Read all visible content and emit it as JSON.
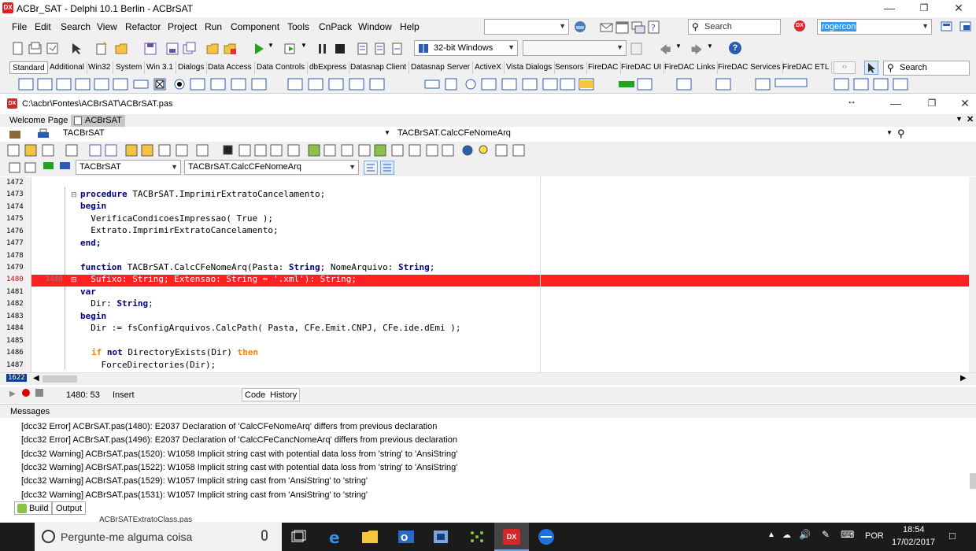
{
  "window": {
    "title": "ACBr_SAT - Delphi 10.1 Berlin - ACBrSAT",
    "logo": "DX"
  },
  "menu": [
    "File",
    "Edit",
    "Search",
    "View",
    "Refactor",
    "Project",
    "Run",
    "Component",
    "Tools",
    "CnPack",
    "Window",
    "Help"
  ],
  "toolbar": {
    "search_placeholder": "Search",
    "layout_value": "rogercon",
    "platform": "32-bit Windows",
    "help_label": "?"
  },
  "palette": {
    "tabs": [
      "Standard",
      "Additional",
      "Win32",
      "System",
      "Win 3.1",
      "Dialogs",
      "Data Access",
      "Data Controls",
      "dbExpress",
      "Datasnap Client",
      "Datasnap Server",
      "ActiveX",
      "Vista Dialogs",
      "Sensors",
      "FireDAC",
      "FireDAC UI",
      "FireDAC Links",
      "FireDAC Services",
      "FireDAC ETL"
    ],
    "search_placeholder": "Search"
  },
  "editor": {
    "path": "C:\\acbr\\Fontes\\ACBrSAT\\ACBrSAT.pas",
    "tabs": [
      "Welcome Page",
      "ACBrSAT"
    ],
    "nav_class": "TACBrSAT",
    "nav_method": "TACBrSAT.CalcCFeNomeArq",
    "combo_class": "TACBrSAT",
    "combo_method": "TACBrSAT.CalcCFeNomeArq",
    "line_numbers": [
      "1472",
      "1473",
      "1474",
      "1475",
      "1476",
      "1477",
      "1478",
      "1479",
      "1480",
      "1481",
      "1482",
      "1483",
      "1484",
      "1485",
      "1486",
      "1487"
    ],
    "error_marker": "1480",
    "current_line_badge": "1622",
    "code": {
      "l1473a": "procedure",
      "l1473b": " TACBrSAT.ImprimirExtratoCancelamento;",
      "l1474": "begin",
      "l1475": "  VerificaCondicoesImpressao( True );",
      "l1476": "  Extrato.ImprimirExtratoCancelamento;",
      "l1477": "end;",
      "l1479a": "function",
      "l1479b": " TACBrSAT.CalcCFeNomeArq(Pasta: ",
      "l1479c": "String",
      "l1479d": "; NomeArquivo: ",
      "l1479e": "String",
      "l1479f": ";",
      "l1480": "  Sufixo: String; Extensao: String = '.xml'): String;",
      "l1481": "var",
      "l1482a": "  Dir: ",
      "l1482b": "String",
      "l1482c": ";",
      "l1483": "begin",
      "l1484": "  Dir := fsConfigArquivos.CalcPath( Pasta, CFe.Emit.CNPJ, CFe.ide.dEmi );",
      "l1486a": "if",
      "l1486b": "not",
      "l1486c": " DirectoryExists(Dir) ",
      "l1486d": "then",
      "l1487": "    ForceDirectories(Dir);"
    },
    "status": {
      "position": "1480: 53",
      "mode": "Insert",
      "code_tab": "Code",
      "history_tab": "History"
    }
  },
  "messages": {
    "title": "Messages",
    "items": [
      "[dcc32 Error] ACBrSAT.pas(1480): E2037 Declaration of 'CalcCFeNomeArq' differs from previous declaration",
      "[dcc32 Error] ACBrSAT.pas(1496): E2037 Declaration of 'CalcCFeCancNomeArq' differs from previous declaration",
      "[dcc32 Warning] ACBrSAT.pas(1520): W1058 Implicit string cast with potential data loss from 'string' to 'AnsiString'",
      "[dcc32 Warning] ACBrSAT.pas(1522): W1058 Implicit string cast with potential data loss from 'string' to 'AnsiString'",
      "[dcc32 Warning] ACBrSAT.pas(1529): W1057 Implicit string cast from 'AnsiString' to 'string'",
      "[dcc32 Warning] ACBrSAT.pas(1531): W1057 Implicit string cast from 'AnsiString' to 'string'"
    ],
    "tabs": [
      "Build",
      "Output"
    ],
    "behind_text": "ACBrSATExtratoClass.pas"
  },
  "taskbar": {
    "search_placeholder": "Pergunte-me alguma coisa",
    "language": "POR",
    "time": "18:54",
    "date": "17/02/2017"
  },
  "colors": {
    "error_line": "#ff2020",
    "keyword": "#000080",
    "keyword_orange": "#ff8000",
    "brand": "#d9252a"
  }
}
